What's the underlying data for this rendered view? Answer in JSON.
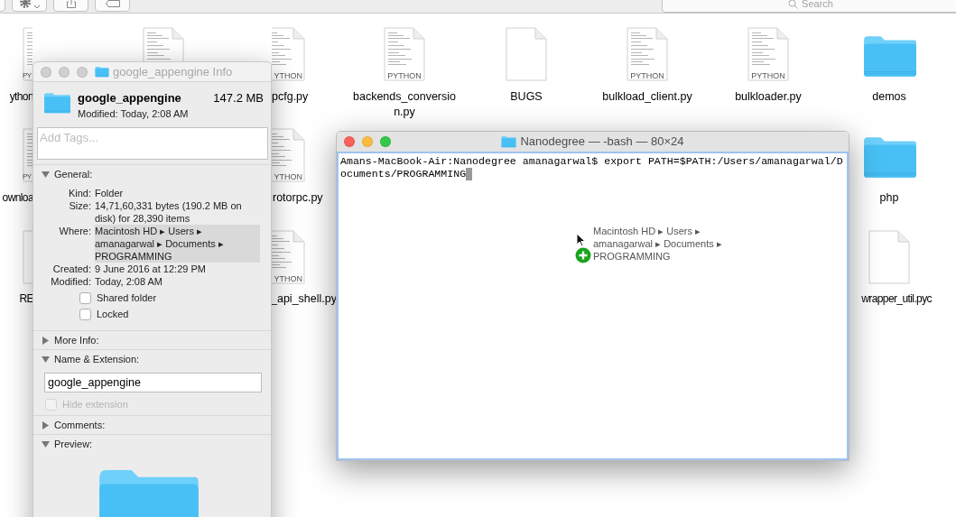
{
  "finder": {
    "toolbar": {
      "search": {
        "placeholder": "Search"
      }
    },
    "files": [
      {
        "kind": "python",
        "label": "ython",
        "badge": "PY"
      },
      {
        "kind": "python"
      },
      {
        "kind": "python",
        "label": "pcfg.py",
        "badge": "YTHON"
      },
      {
        "kind": "python",
        "label": "backends_conversion.py",
        "badge": "PYTHON"
      },
      {
        "kind": "document",
        "label": "BUGS"
      },
      {
        "kind": "python",
        "label": "bulkload_client.py",
        "badge": "PYTHON"
      },
      {
        "kind": "python",
        "label": "bulkloader.py",
        "badge": "PYTHON"
      },
      {
        "kind": "folder",
        "label": "demos"
      },
      {
        "kind": "python",
        "label": "ownloa",
        "badge": "PY"
      },
      {
        "kind": "python",
        "label": "rotorpc.py",
        "badge": "YTHON"
      },
      {
        "kind": "folder",
        "label": "php"
      },
      {
        "kind": "document",
        "label": "RE"
      },
      {
        "kind": "python",
        "label": "_api_shell.py",
        "badge": "YTHON"
      },
      {
        "kind": "document",
        "label": "wrapper_util.pyc"
      }
    ]
  },
  "info_window": {
    "title": "google_appengine Info",
    "name": "google_appengine",
    "size": "147.2 MB",
    "modified": "Modified: Today, 2:08 AM",
    "tags": {
      "placeholder": "Add Tags..."
    },
    "sections": [
      {
        "kind": "general",
        "title": "General:",
        "expanded": true,
        "rows": [
          {
            "label": "Kind:",
            "value": "Folder",
            "highlighted": false
          },
          {
            "label": "Size:",
            "value": "14,71,60,331 bytes (190.2 MB on disk) for 28,390 items",
            "highlighted": false
          },
          {
            "label": "Where:",
            "value": "Macintosh HD ▸ Users ▸ amanagarwal ▸ Documents ▸ PROGRAMMING",
            "highlighted": true
          },
          {
            "label": "Created:",
            "value": "9 June 2016 at 12:29 PM",
            "highlighted": false
          },
          {
            "label": "Modified:",
            "value": "Today, 2:08 AM",
            "highlighted": false
          }
        ],
        "checkboxes": [
          {
            "label": "Shared folder",
            "checked": false,
            "disabled": false
          },
          {
            "label": "Locked",
            "checked": false,
            "disabled": false
          }
        ]
      },
      {
        "kind": "more_info",
        "title": "More Info:",
        "expanded": false
      },
      {
        "kind": "name_extension",
        "title": "Name & Extension:",
        "expanded": true,
        "value": "google_appengine",
        "checkboxes": [
          {
            "label": "Hide extension",
            "checked": false,
            "disabled": true
          }
        ]
      },
      {
        "kind": "comments",
        "title": "Comments:",
        "expanded": false
      },
      {
        "kind": "preview",
        "title": "Preview:",
        "expanded": true
      }
    ]
  },
  "terminal": {
    "title": "Nanodegree — -bash — 80×24",
    "lines": [
      "Amans-MacBook-Air:Nanodegree amanagarwal$ export PATH=$PATH:/Users/amanagarwal/D",
      "ocuments/PROGRAMMING"
    ],
    "drag_label": [
      "Macintosh HD ▸ Users ▸",
      "amanagarwal ▸ Documents ▸",
      "PROGRAMMING"
    ]
  }
}
